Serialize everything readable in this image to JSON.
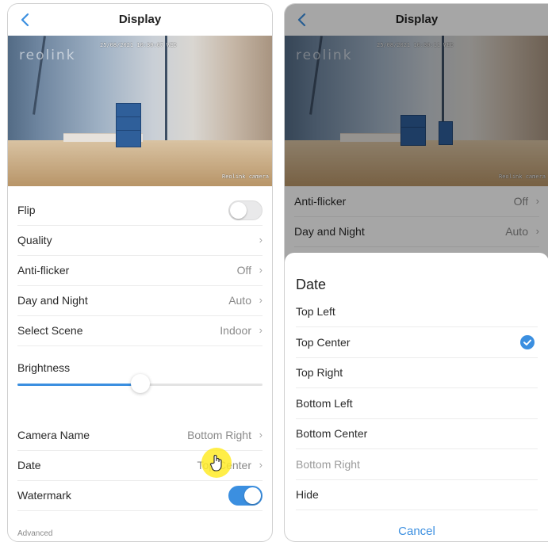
{
  "colors": {
    "accent": "#3b8fe0",
    "text": "#2a2a2a",
    "muted": "#8a8a8a"
  },
  "left": {
    "header": {
      "title": "Display",
      "back_icon": "chevron-left-icon"
    },
    "preview": {
      "logo": "reolink",
      "timestamp": "25/08/2021 10:30:07 WED",
      "camera_name": "Reolink camera"
    },
    "rows": {
      "flip": {
        "label": "Flip",
        "toggle_on": false
      },
      "quality": {
        "label": "Quality"
      },
      "anti_flicker": {
        "label": "Anti-flicker",
        "value": "Off"
      },
      "day_night": {
        "label": "Day and Night",
        "value": "Auto"
      },
      "scene": {
        "label": "Select Scene",
        "value": "Indoor"
      },
      "camera_name": {
        "label": "Camera Name",
        "value": "Bottom Right"
      },
      "date": {
        "label": "Date",
        "value": "Top Center"
      },
      "watermark": {
        "label": "Watermark",
        "toggle_on": true
      }
    },
    "brightness": {
      "label": "Brightness",
      "level": 0.5
    },
    "advanced": "Advanced"
  },
  "right": {
    "header": {
      "title": "Display",
      "back_icon": "chevron-left-icon"
    },
    "preview": {
      "logo": "reolink",
      "timestamp": "25/08/2021 10:30:11 WED",
      "camera_name": "Reolink camera"
    },
    "rows": {
      "anti_flicker": {
        "label": "Anti-flicker",
        "value": "Off"
      },
      "day_night": {
        "label": "Day and Night",
        "value": "Auto"
      }
    },
    "sheet": {
      "title": "Date",
      "options": [
        {
          "label": "Top Left",
          "selected": false,
          "disabled": false
        },
        {
          "label": "Top Center",
          "selected": true,
          "disabled": false
        },
        {
          "label": "Top Right",
          "selected": false,
          "disabled": false
        },
        {
          "label": "Bottom Left",
          "selected": false,
          "disabled": false
        },
        {
          "label": "Bottom Center",
          "selected": false,
          "disabled": false
        },
        {
          "label": "Bottom Right",
          "selected": false,
          "disabled": true
        },
        {
          "label": "Hide",
          "selected": false,
          "disabled": false
        }
      ],
      "cancel": "Cancel"
    }
  }
}
